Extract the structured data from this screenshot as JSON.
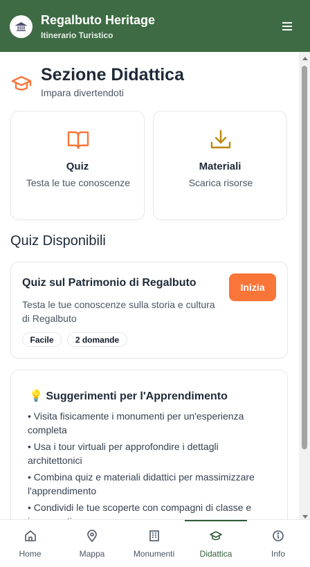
{
  "header": {
    "title": "Regalbuto Heritage",
    "subtitle": "Itinerario Turistico",
    "logo_icon": "museum-icon",
    "menu_icon": "hamburger-menu-icon"
  },
  "section": {
    "title": "Sezione Didattica",
    "subtitle": "Impara divertendoti",
    "icon": "graduation-cap-icon"
  },
  "features": [
    {
      "title": "Quiz",
      "description": "Testa le tue conoscenze",
      "icon": "book-open-icon"
    },
    {
      "title": "Materiali",
      "description": "Scarica risorse",
      "icon": "download-icon"
    }
  ],
  "quizzes_heading": "Quiz Disponibili",
  "quiz": {
    "title": "Quiz sul Patrimonio di Regalbuto",
    "description": "Testa le tue conoscenze sulla storia e cultura di Regalbuto",
    "start_label": "Inizia",
    "badges": [
      "Facile",
      "2 domande"
    ]
  },
  "tips": {
    "emoji": "💡",
    "title": "Suggerimenti per l'Apprendimento",
    "items": [
      "• Visita fisicamente i monumenti per un'esperienza completa",
      "• Usa i tour virtuali per approfondire i dettagli architettonici",
      "• Combina quiz e materiali didattici per massimizzare l'apprendimento",
      "• Condividi le tue scoperte con compagni di classe e insegnanti"
    ]
  },
  "nav": {
    "items": [
      {
        "label": "Home",
        "icon": "home-icon"
      },
      {
        "label": "Mappa",
        "icon": "map-pin-icon"
      },
      {
        "label": "Monumenti",
        "icon": "building-icon"
      },
      {
        "label": "Didattica",
        "icon": "graduation-cap-icon"
      },
      {
        "label": "Info",
        "icon": "info-icon"
      }
    ],
    "active": "Didattica"
  },
  "colors": {
    "header_bg": "#3e6b44",
    "accent_orange": "#f97538",
    "download_icon": "#b8860b",
    "nav_active": "#2f5a36"
  }
}
